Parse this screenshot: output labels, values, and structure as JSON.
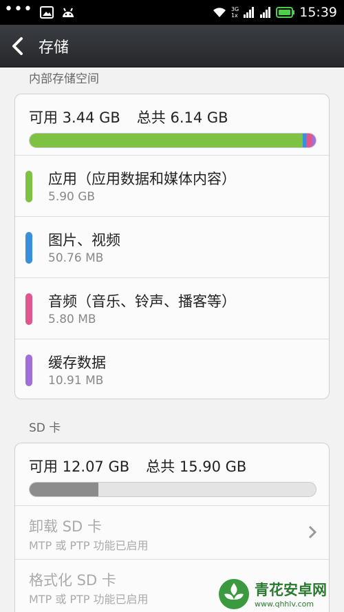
{
  "status_bar": {
    "dots": "•••",
    "network_top": "3G",
    "network_bottom": "1x",
    "time": "15:39"
  },
  "header": {
    "title": "存储"
  },
  "internal": {
    "section_label": "内部存储空间",
    "available": "可用 3.44 GB",
    "total": "总共 6.14 GB",
    "usage": [
      {
        "fraction": 0.955,
        "color": "#7dc242"
      },
      {
        "fraction": 0.012,
        "color": "#3a8fdc"
      },
      {
        "fraction": 0.02,
        "color": "#e0578e"
      },
      {
        "fraction": 0.013,
        "color": "#a070d8"
      }
    ],
    "categories": [
      {
        "name": "应用（应用数据和媒体内容）",
        "size": "5.90 GB",
        "color": "#7dc242"
      },
      {
        "name": "图片、视频",
        "size": "50.76 MB",
        "color": "#3a8fdc"
      },
      {
        "name": "音频（音乐、铃声、播客等）",
        "size": "5.80 MB",
        "color": "#e0578e"
      },
      {
        "name": "缓存数据",
        "size": "10.91 MB",
        "color": "#a070d8"
      }
    ]
  },
  "sd": {
    "section_label": "SD 卡",
    "available": "可用 12.07 GB",
    "total": "总共 15.90 GB",
    "used_fraction": 0.241,
    "used_color": "#8c8c8c",
    "unmount_label": "卸载 SD 卡",
    "unmount_sub": "MTP 或 PTP 功能已启用",
    "format_label": "格式化 SD 卡",
    "format_sub": "MTP 或 PTP 功能已启用"
  },
  "watermark": {
    "name": "青花安卓网",
    "url": "www.qhhlv.com"
  }
}
